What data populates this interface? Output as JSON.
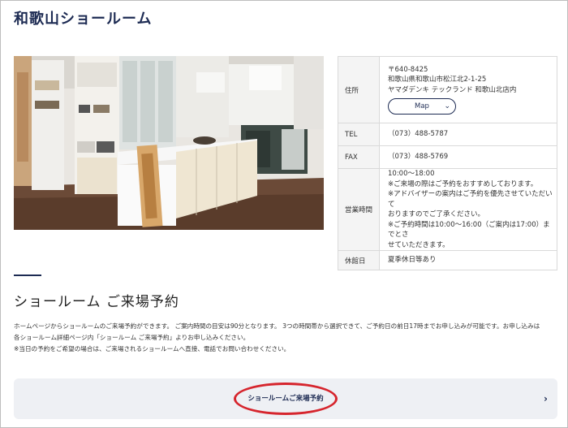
{
  "page_title": "和歌山ショールーム",
  "info": {
    "address_label": "住所",
    "postal": "〒640-8425",
    "address_line": "和歌山県和歌山市松江北2-1-25",
    "store_line": "ヤマダデンキ テックランド 和歌山北店内",
    "map_label": "Map",
    "tel_label": "TEL",
    "tel": "（073）488-5787",
    "fax_label": "FAX",
    "fax": "（073）488-5769",
    "hours_label": "営業時間",
    "hours": [
      "10:00～18:00",
      "※ご来場の際はご予約をおすすめしております。",
      "※アドバイザーの案内はご予約を優先させていただいて",
      "おりますのでご了承ください。",
      "※ご予約時間は10:00～16:00（ご案内は17:00）までとさ",
      "せていただきます。"
    ],
    "closed_label": "休館日",
    "closed": "夏季休日等あり"
  },
  "reservation": {
    "heading": "ショールーム ご来場予約",
    "desc": [
      "ホームページからショールームのご来場予約ができます。 ご案内時間の目安は90分となります。 3つの時間帯から選択できて、ご予約日の前日17時までお申し込みが可能です。お申し込みは",
      "各ショールーム詳細ページ内「ショールーム ご来場予約」よりお申し込みください。",
      "※当日の予約をご希望の場合は、ご来場されるショールームへ直接、電話でお問い合わせください。"
    ],
    "button_label": "ショールームご来場予約"
  },
  "icons": {
    "map_chevron": "chevron-down-icon",
    "cta_arrow": "chevron-right-icon"
  },
  "colors": {
    "navy": "#1d2b53",
    "highlight_ring": "#d6252d",
    "cta_bg": "#eef0f4"
  }
}
